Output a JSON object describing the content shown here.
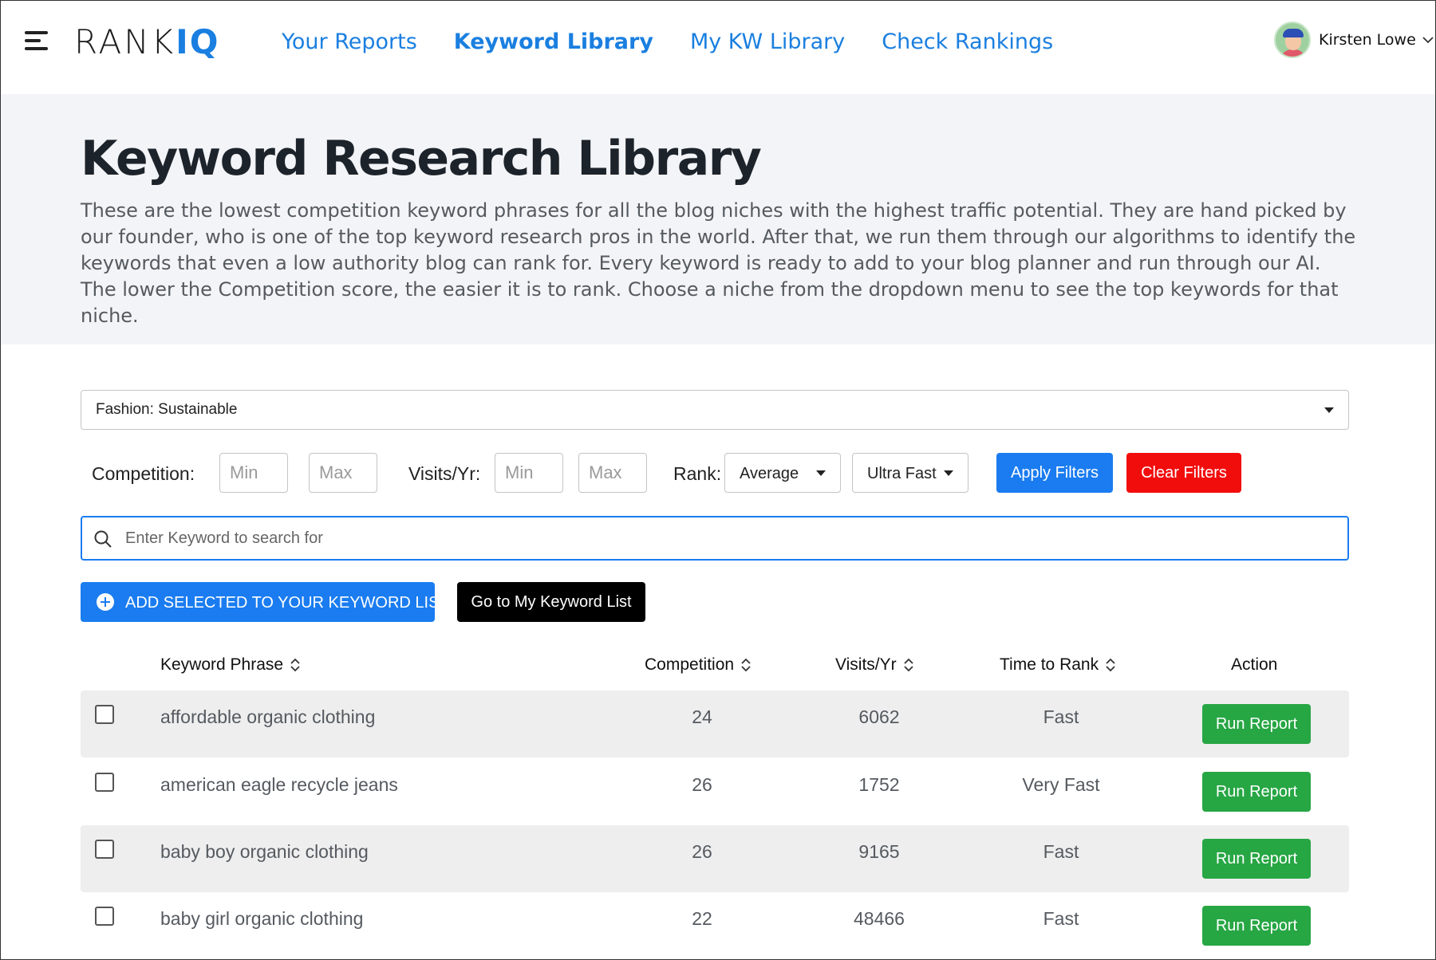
{
  "nav": {
    "logo_text": "RANK",
    "logo_accent": "IQ",
    "links": [
      {
        "label": "Your Reports",
        "active": false
      },
      {
        "label": "Keyword Library",
        "active": true
      },
      {
        "label": "My KW Library",
        "active": false
      },
      {
        "label": "Check Rankings",
        "active": false
      }
    ],
    "user_name": "Kirsten Lowe"
  },
  "hero": {
    "title": "Keyword Research Library",
    "description": "These are the lowest competition keyword phrases for all the blog niches with the highest traffic potential. They are hand picked by our founder, who is one of the top keyword research pros in the world. After that, we run them through our algorithms to identify the keywords that even a low authority blog can rank for. Every keyword is ready to add to your blog planner and run through our AI. The lower the Competition score, the easier it is to rank. Choose a niche from the dropdown menu to see the top keywords for that niche."
  },
  "filters": {
    "niche_selected": "Fashion: Sustainable",
    "competition_label": "Competition:",
    "visits_label": "Visits/Yr:",
    "rank_label": "Rank:",
    "min_placeholder": "Min",
    "max_placeholder": "Max",
    "rank_selected": "Average",
    "speed_selected": "Ultra Fast",
    "apply_label": "Apply Filters",
    "clear_label": "Clear Filters"
  },
  "search": {
    "placeholder": "Enter Keyword to search for"
  },
  "actions": {
    "add_selected_label": "ADD SELECTED TO YOUR KEYWORD LIST",
    "go_to_list_label": "Go to My Keyword List"
  },
  "table": {
    "headers": {
      "keyword": "Keyword Phrase",
      "competition": "Competition",
      "visits": "Visits/Yr",
      "time_to_rank": "Time to Rank",
      "action": "Action"
    },
    "rows": [
      {
        "keyword": "affordable organic clothing",
        "competition": "24",
        "visits": "6062",
        "time": "Fast",
        "action": "Run Report"
      },
      {
        "keyword": "american eagle recycle jeans",
        "competition": "26",
        "visits": "1752",
        "time": "Very Fast",
        "action": "Run Report"
      },
      {
        "keyword": "baby boy organic clothing",
        "competition": "26",
        "visits": "9165",
        "time": "Fast",
        "action": "Run Report"
      },
      {
        "keyword": "baby girl organic clothing",
        "competition": "22",
        "visits": "48466",
        "time": "Fast",
        "action": "Run Report"
      }
    ]
  },
  "colors": {
    "brand_blue": "#1a7cf0",
    "danger_red": "#f20d0d",
    "success_green": "#27a644"
  }
}
